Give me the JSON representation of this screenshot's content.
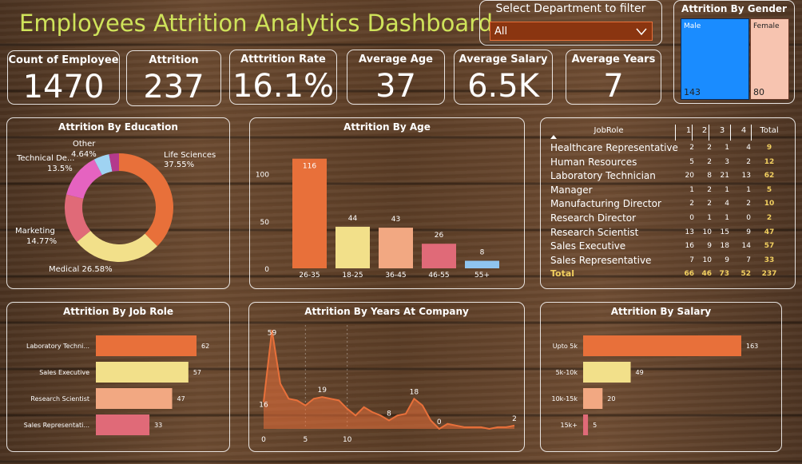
{
  "title": "Employees Attrition Analytics Dashboard",
  "filter": {
    "label": "Select Department to filter",
    "value": "All"
  },
  "kpis": [
    {
      "label": "Count of Employee",
      "value": "1470"
    },
    {
      "label": "Attrition",
      "value": "237"
    },
    {
      "label": "Atttrition Rate",
      "value": "16.1%"
    },
    {
      "label": "Average Age",
      "value": "37"
    },
    {
      "label": "Average Salary",
      "value": "6.5K"
    },
    {
      "label": "Average Years",
      "value": "7"
    }
  ],
  "gender": {
    "title": "Attrition By Gender",
    "male_label": "Male",
    "female_label": "Female",
    "male_value": "143",
    "female_value": "80",
    "male_color": "#1a8cff",
    "female_color": "#f7c4b0"
  },
  "education": {
    "title": "Attrition By Education"
  },
  "age": {
    "title": "Attrition By Age"
  },
  "table": {
    "header": [
      "JobRole",
      "1",
      "2",
      "3",
      "4",
      "Total"
    ],
    "rows": [
      [
        "Healthcare Representative",
        "2",
        "2",
        "1",
        "4",
        "9"
      ],
      [
        "Human Resources",
        "5",
        "2",
        "3",
        "2",
        "12"
      ],
      [
        "Laboratory Technician",
        "20",
        "8",
        "21",
        "13",
        "62"
      ],
      [
        "Manager",
        "1",
        "2",
        "1",
        "1",
        "5"
      ],
      [
        "Manufacturing Director",
        "2",
        "2",
        "4",
        "2",
        "10"
      ],
      [
        "Research Director",
        "0",
        "1",
        "1",
        "0",
        "2"
      ],
      [
        "Research Scientist",
        "13",
        "10",
        "15",
        "9",
        "47"
      ],
      [
        "Sales Executive",
        "16",
        "9",
        "18",
        "14",
        "57"
      ],
      [
        "Sales Representative",
        "7",
        "10",
        "9",
        "7",
        "33"
      ]
    ],
    "total": [
      "Total",
      "66",
      "46",
      "73",
      "52",
      "237"
    ]
  },
  "jobrole": {
    "title": "Attrition By Job Role"
  },
  "years": {
    "title": "Attrition By Years At Company"
  },
  "salary": {
    "title": "Attrition By Salary"
  },
  "chart_data": [
    {
      "type": "pie",
      "title": "Attrition By Education",
      "labels": [
        "Life Sciences",
        "Medical",
        "Marketing",
        "Technical De...",
        "Other"
      ],
      "label_texts": [
        "Life Sciences 37.55%",
        "Medical 26.58%",
        "Marketing 14.77%",
        "Technical De... 13.5%",
        "Other 4.64%"
      ],
      "values": [
        37.55,
        26.58,
        14.77,
        13.5,
        4.64,
        2.96
      ],
      "colors": [
        "#e8703a",
        "#f2e08a",
        "#e06a78",
        "#e563c0",
        "#9fd3f2",
        "#b43a8c"
      ]
    },
    {
      "type": "bar",
      "title": "Attrition By Age",
      "categories": [
        "26-35",
        "18-25",
        "36-45",
        "46-55",
        "55+"
      ],
      "values": [
        116,
        44,
        43,
        26,
        8
      ],
      "ylim": [
        0,
        125
      ],
      "yticks": [
        0,
        50,
        100
      ],
      "colors": [
        "#e8703a",
        "#f2e08a",
        "#f2a882",
        "#e06a78",
        "#8fc4ef"
      ]
    },
    {
      "type": "bar",
      "title": "Attrition By Job Role",
      "orientation": "horizontal",
      "categories": [
        "Laboratory Techni...",
        "Sales Executive",
        "Research Scientist",
        "Sales Representati..."
      ],
      "values": [
        62,
        57,
        47,
        33
      ],
      "colors": [
        "#e8703a",
        "#f2e08a",
        "#f2a882",
        "#e06a78"
      ]
    },
    {
      "type": "area",
      "title": "Attrition By Years At Company",
      "x": [
        0,
        1,
        2,
        3,
        4,
        5,
        6,
        7,
        8,
        9,
        10,
        11,
        12,
        13,
        14,
        15,
        16,
        17,
        18,
        19,
        20,
        21,
        22,
        23,
        24,
        25,
        26,
        27,
        28,
        29,
        30
      ],
      "values": [
        16,
        59,
        27,
        18,
        17,
        14,
        18,
        19,
        18,
        17,
        12,
        8,
        13,
        10,
        8,
        5,
        8,
        9,
        18,
        14,
        5,
        0,
        3,
        2,
        1,
        1,
        1,
        0,
        1,
        1,
        2
      ],
      "labeled_points": [
        [
          0,
          "16"
        ],
        [
          1,
          "59"
        ],
        [
          7,
          "19"
        ],
        [
          15,
          "8"
        ],
        [
          18,
          "18"
        ],
        [
          21,
          "0"
        ],
        [
          30,
          "2"
        ]
      ],
      "xticks": [
        "0",
        "5",
        "10"
      ],
      "ylim": [
        0,
        62
      ]
    },
    {
      "type": "bar",
      "title": "Attrition By Salary",
      "orientation": "horizontal",
      "categories": [
        "Upto 5k",
        "5k-10k",
        "10k-15k",
        "15k+"
      ],
      "values": [
        163,
        49,
        20,
        5
      ],
      "colors": [
        "#e8703a",
        "#f2e08a",
        "#f2a882",
        "#e06a78"
      ]
    }
  ]
}
